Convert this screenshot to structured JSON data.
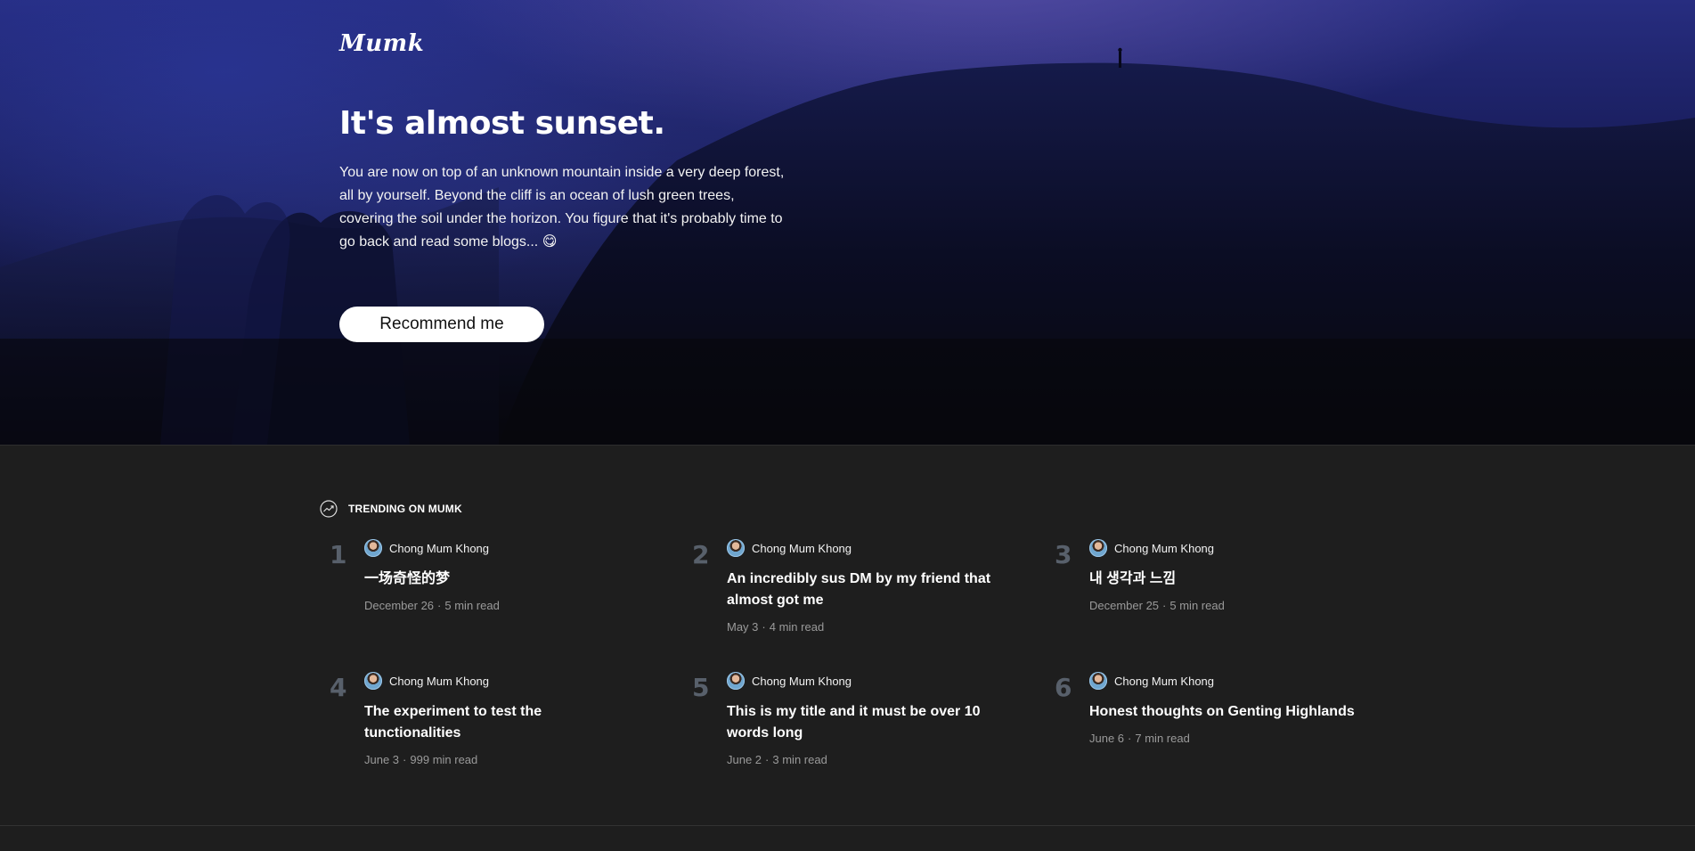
{
  "brand": {
    "logo": "Mumk"
  },
  "hero": {
    "title": "It's almost sunset.",
    "text": "You are now on top of an unknown mountain inside a very deep forest, all by yourself. Beyond the cliff is an ocean of lush green trees, covering the soil under the horizon. You figure that it's probably time to go back and read some blogs... 😋",
    "cta": "Recommend me"
  },
  "trending": {
    "label": "TRENDING ON MUMK",
    "posts": [
      {
        "rank": "1",
        "author": "Chong Mum Khong",
        "title": "一场奇怪的梦",
        "date": "December 26",
        "read": "5 min read"
      },
      {
        "rank": "2",
        "author": "Chong Mum Khong",
        "title": "An incredibly sus DM by my friend that almost got me",
        "date": "May 3",
        "read": "4 min read"
      },
      {
        "rank": "3",
        "author": "Chong Mum Khong",
        "title": "내 생각과 느낌",
        "date": "December 25",
        "read": "5 min read"
      },
      {
        "rank": "4",
        "author": "Chong Mum Khong",
        "title": "The experiment to test the tunctionalities",
        "date": "June 3",
        "read": "999 min read"
      },
      {
        "rank": "5",
        "author": "Chong Mum Khong",
        "title": "This is my title and it must be over 10 words long",
        "date": "June 2",
        "read": "3 min read"
      },
      {
        "rank": "6",
        "author": "Chong Mum Khong",
        "title": "Honest thoughts on Genting Highlands",
        "date": "June 6",
        "read": "7 min read"
      }
    ]
  },
  "icons": {
    "trending": "trending-up-icon",
    "avatar": "user-avatar"
  },
  "colors": {
    "background": "#1e1e1e",
    "rank": "#58606b",
    "meta": "#9a9a9a",
    "cta_bg": "#ffffff"
  }
}
